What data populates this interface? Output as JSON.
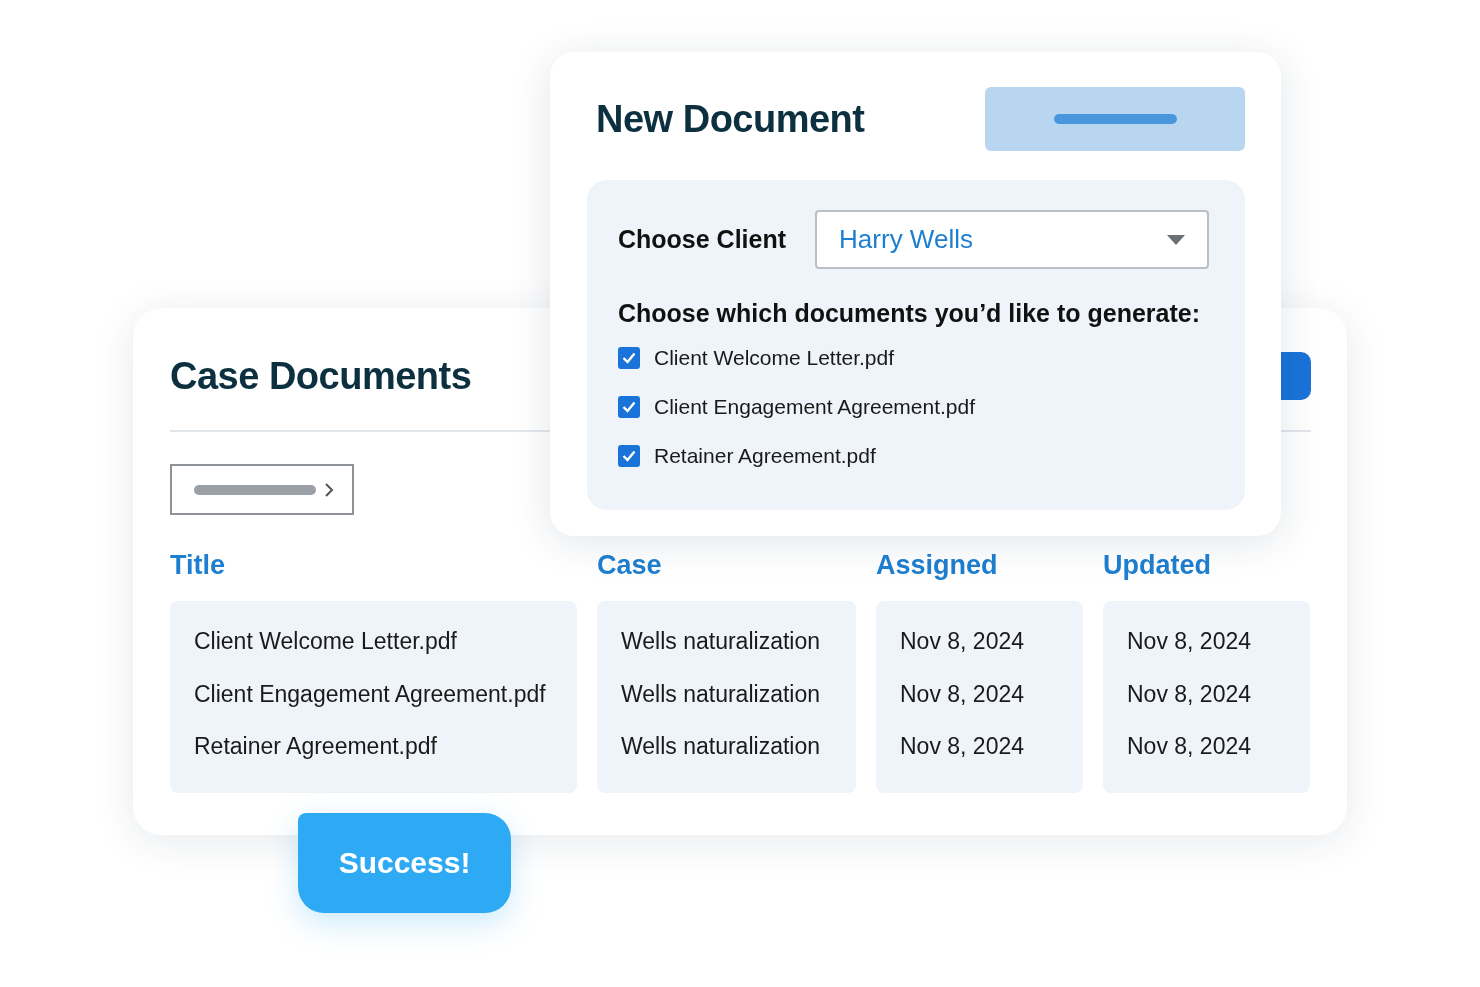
{
  "case_documents": {
    "title": "Case Documents",
    "columns": [
      {
        "header": "Title",
        "cells": [
          "Client Welcome Letter.pdf",
          "Client Engagement Agreement.pdf",
          "Retainer Agreement.pdf"
        ]
      },
      {
        "header": "Case",
        "cells": [
          "Wells naturalization",
          "Wells naturalization",
          "Wells naturalization"
        ]
      },
      {
        "header": "Assigned",
        "cells": [
          "Nov 8, 2024",
          "Nov 8, 2024",
          "Nov 8, 2024"
        ]
      },
      {
        "header": "Updated",
        "cells": [
          "Nov 8, 2024",
          "Nov 8, 2024",
          "Nov 8, 2024"
        ]
      }
    ]
  },
  "new_document": {
    "title": "New Document",
    "client_label": "Choose Client",
    "client": "Harry Wells",
    "documents_label": "Choose which documents you’d like to generate:",
    "documents": [
      {
        "name": "Client Welcome Letter.pdf",
        "checked": true
      },
      {
        "name": "Client Engagement Agreement.pdf",
        "checked": true
      },
      {
        "name": "Retainer Agreement.pdf",
        "checked": true
      }
    ]
  },
  "toast": "Success!"
}
